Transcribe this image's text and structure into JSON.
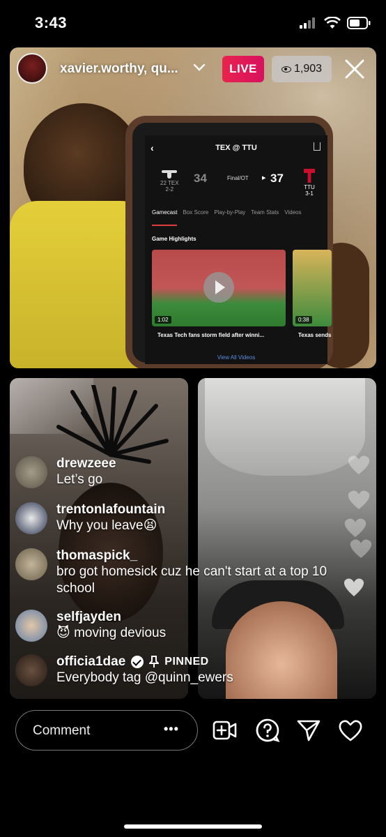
{
  "status_bar": {
    "time": "3:43"
  },
  "live": {
    "host_name": "xavier.worthy, qu...",
    "live_label": "LIVE",
    "viewer_count": "1,903"
  },
  "phone_screen": {
    "title": "TEX @ TTU",
    "home_team_rank": "22 TEX",
    "home_record": "2-2",
    "home_score": "34",
    "status": "Final/OT",
    "away_team": "TTU",
    "away_record": "3-1",
    "away_score": "37",
    "tabs": [
      "Gamecast",
      "Box Score",
      "Play-by-Play",
      "Team Stats",
      "Videos"
    ],
    "section_title": "Game Highlights",
    "videos": [
      {
        "duration": "1:02",
        "caption": "Texas Tech fans storm field after winni..."
      },
      {
        "duration": "0:38",
        "caption": "Texas sends"
      }
    ],
    "view_all": "View All Videos"
  },
  "comments": [
    {
      "user": "drewzeee",
      "text": "Let’s go",
      "avatar_color": "#8a8a7a"
    },
    {
      "user": "trentonlafountain",
      "text": "Why you leave😫",
      "avatar_color": "#3b4a6a"
    },
    {
      "user": "thomaspick_",
      "text": "bro got homesick cuz he can't start at a top 10 school",
      "avatar_color": "#7a6e5a"
    },
    {
      "user": "selfjayden",
      "text": "😈 moving devious",
      "avatar_color": "#9ab0c8"
    },
    {
      "user": "officia1dae",
      "text": "Everybody tag @quinn_ewers",
      "pinned_label": "PINNED",
      "avatar_color": "#4a3a30"
    }
  ],
  "bottom_bar": {
    "comment_placeholder": "Comment",
    "more": "•••"
  },
  "icons": {
    "close": "close-icon",
    "add_video": "add-video-icon",
    "question": "question-icon",
    "send": "send-icon",
    "like": "heart-icon"
  }
}
